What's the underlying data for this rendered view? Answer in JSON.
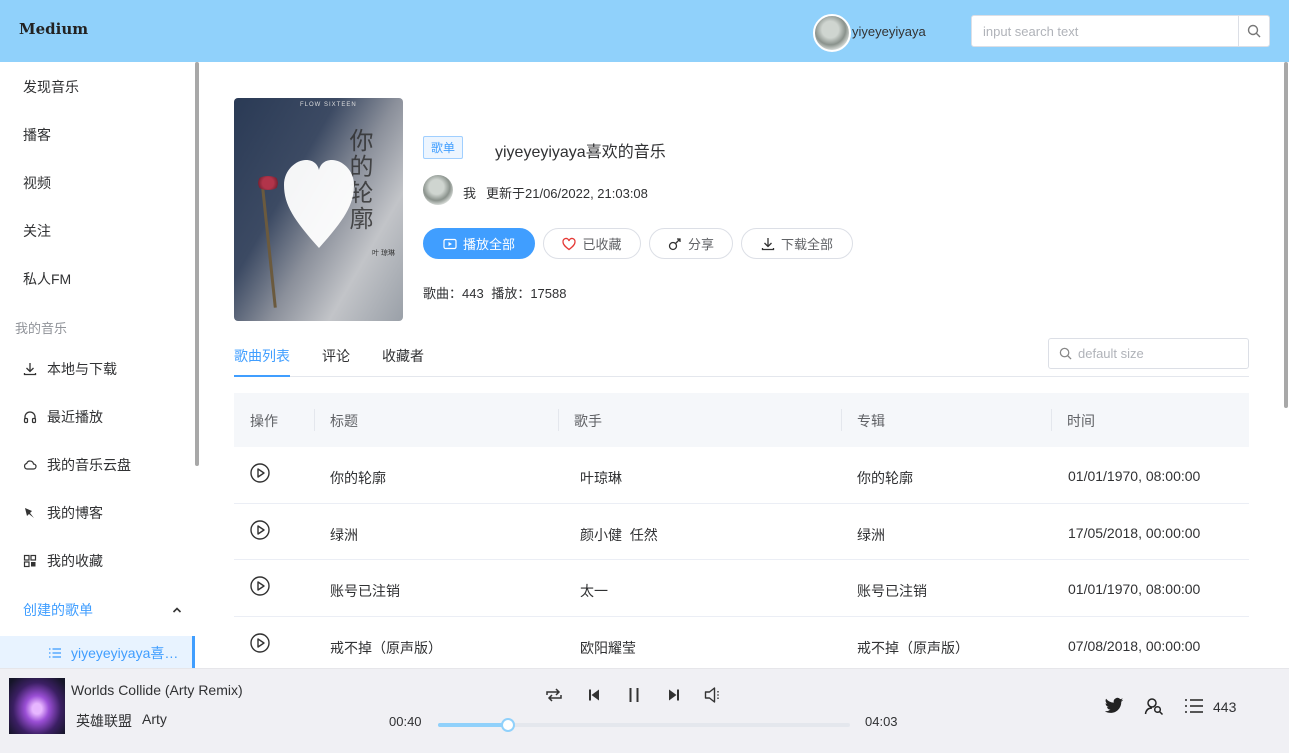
{
  "header": {
    "brand": "Medium",
    "username": "yiyeyeyiyaya",
    "search_placeholder": "input search text"
  },
  "sidebar": {
    "items": [
      {
        "label": "发现音乐"
      },
      {
        "label": "播客"
      },
      {
        "label": "视频"
      },
      {
        "label": "关注"
      },
      {
        "label": "私人FM"
      }
    ],
    "group_label": "我的音乐",
    "my_music": [
      {
        "label": "本地与下载",
        "icon": "download-icon"
      },
      {
        "label": "最近播放",
        "icon": "headphones-icon"
      },
      {
        "label": "我的音乐云盘",
        "icon": "cloud-icon"
      },
      {
        "label": "我的博客",
        "icon": "brush-icon"
      },
      {
        "label": "我的收藏",
        "icon": "grid-icon"
      }
    ],
    "created_label": "创建的歌单",
    "created_playlist": "yiyeyeyiyaya喜…"
  },
  "playlist": {
    "tag": "歌单",
    "title": "yiyeyeyiyaya喜欢的音乐",
    "owner": "我",
    "updated": "更新于21/06/2022, 21:03:08",
    "buttons": {
      "play_all": "播放全部",
      "collected": "已收藏",
      "share": "分享",
      "download_all": "下载全部"
    },
    "songs_label": "歌曲：443",
    "plays_label": "播放：17588",
    "cover": {
      "title": "你的轮廓",
      "brand": "FLOW SIXTEEN",
      "singer": "叶 琼琳"
    }
  },
  "tabs": {
    "items": [
      "歌曲列表",
      "评论",
      "收藏者"
    ],
    "active": 0,
    "search_placeholder": "default size"
  },
  "table": {
    "headers": [
      "操作",
      "标题",
      "歌手",
      "专辑",
      "时间"
    ],
    "rows": [
      {
        "title": "你的轮廓",
        "artist": "叶琼琳",
        "album": "你的轮廓",
        "time": "01/01/1970, 08:00:00"
      },
      {
        "title": "绿洲",
        "artist": "颜小健  任然",
        "album": "绿洲",
        "time": "17/05/2018, 00:00:00"
      },
      {
        "title": "账号已注销",
        "artist": "太一",
        "album": "账号已注销",
        "time": "01/01/1970, 08:00:00"
      },
      {
        "title": "戒不掉（原声版）",
        "artist": "欧阳耀莹",
        "album": "戒不掉（原声版）",
        "time": "07/08/2018, 00:00:00"
      }
    ]
  },
  "player": {
    "title": "Worlds Collide (Arty Remix)",
    "album": "英雄联盟",
    "artist": "Arty",
    "current_time": "00:40",
    "total_time": "04:03",
    "progress_fraction": 0.17,
    "queue_count": "443"
  },
  "colors": {
    "header_bg": "#90d1fb",
    "accent": "#409eff",
    "player_bg": "#f0f0f4"
  }
}
